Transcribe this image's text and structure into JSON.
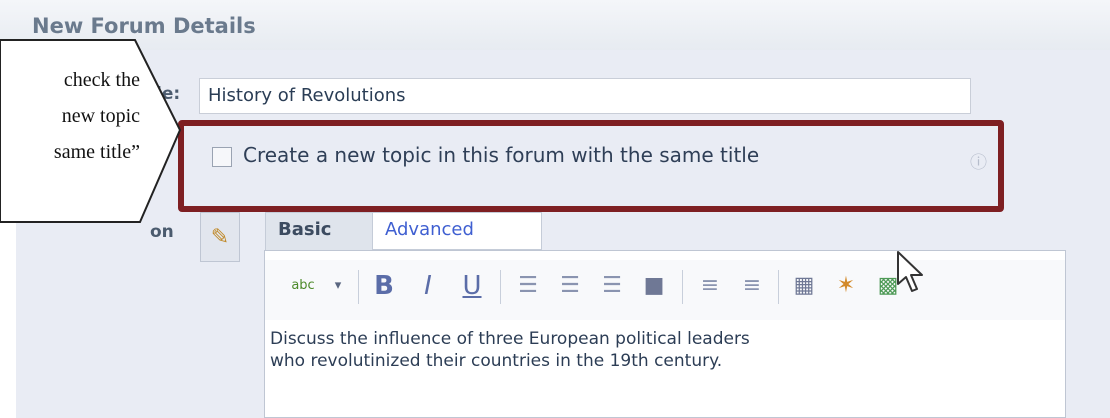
{
  "section_header": {
    "title": "New Forum Details"
  },
  "form": {
    "title_label_fragment": "le:",
    "title_value": "History of Revolutions",
    "description_label_fragment": "on",
    "create_topic_label": "Create a new topic in this forum with the same title",
    "help_icon": "help-icon"
  },
  "editor": {
    "tabs": [
      {
        "label": "Basic",
        "active": true
      },
      {
        "label": "Advanced",
        "active": false
      }
    ],
    "toolbar": {
      "spellcheck_label": "abc",
      "bold": "B",
      "italic": "I",
      "underline": "U"
    },
    "body_text": "Discuss the influence of three European political leaders\nwho revolutinized their countries in the 19th century."
  },
  "callout": {
    "lines": [
      "check the",
      "new topic",
      "same title”"
    ]
  },
  "colors": {
    "highlight_border": "#7e1f22",
    "panel_bg": "#e9ecf4",
    "link_blue": "#3f5fd1"
  }
}
